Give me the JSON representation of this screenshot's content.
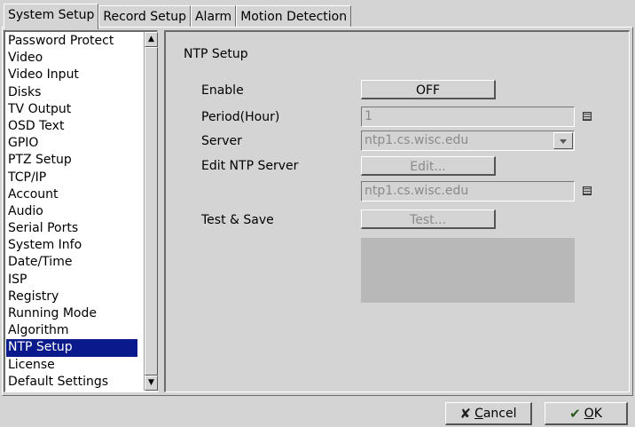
{
  "tabs": [
    {
      "label": "System Setup",
      "active": true
    },
    {
      "label": "Record Setup",
      "active": false
    },
    {
      "label": "Alarm",
      "active": false
    },
    {
      "label": "Motion Detection",
      "active": false
    }
  ],
  "sidebar": {
    "items": [
      "Password Protect",
      "Video",
      "Video Input",
      "Disks",
      "TV Output",
      "OSD Text",
      "GPIO",
      "PTZ Setup",
      "TCP/IP",
      "Account",
      "Audio",
      "Serial Ports",
      "System Info",
      "Date/Time",
      "ISP",
      "Registry",
      "Running Mode",
      "Algorithm",
      "NTP Setup",
      "License",
      "Default Settings"
    ],
    "selected": "NTP Setup"
  },
  "panel": {
    "title": "NTP Setup",
    "enable": {
      "label": "Enable",
      "button": "OFF"
    },
    "period": {
      "label": "Period(Hour)",
      "value": "1"
    },
    "server": {
      "label": "Server",
      "value": "ntp1.cs.wisc.edu"
    },
    "edit_server": {
      "label": "Edit NTP Server",
      "button": "Edit...",
      "value": "ntp1.cs.wisc.edu"
    },
    "test": {
      "label": "Test & Save",
      "button": "Test..."
    }
  },
  "footer": {
    "cancel_rest": "ancel",
    "cancel_mnemonic": "C",
    "ok_mnemonic": "O",
    "ok_rest": "K"
  },
  "icons": {
    "cancel": "x-cross-icon",
    "ok": "checkmark-icon"
  }
}
